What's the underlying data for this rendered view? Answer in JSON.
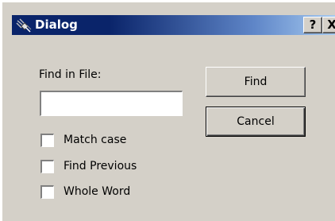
{
  "window": {
    "title": "Dialog",
    "icon": "satellite-icon",
    "help_label": "?",
    "close_label": "X",
    "titlebar_color": "#0a246a",
    "face_color": "#d4d0c8"
  },
  "form": {
    "find_label": "Find in File:",
    "find_value": "",
    "options": [
      {
        "label": "Match case",
        "checked": false
      },
      {
        "label": "Find Previous",
        "checked": false
      },
      {
        "label": "Whole Word",
        "checked": false
      }
    ]
  },
  "buttons": {
    "find_label": "Find",
    "cancel_label": "Cancel"
  }
}
